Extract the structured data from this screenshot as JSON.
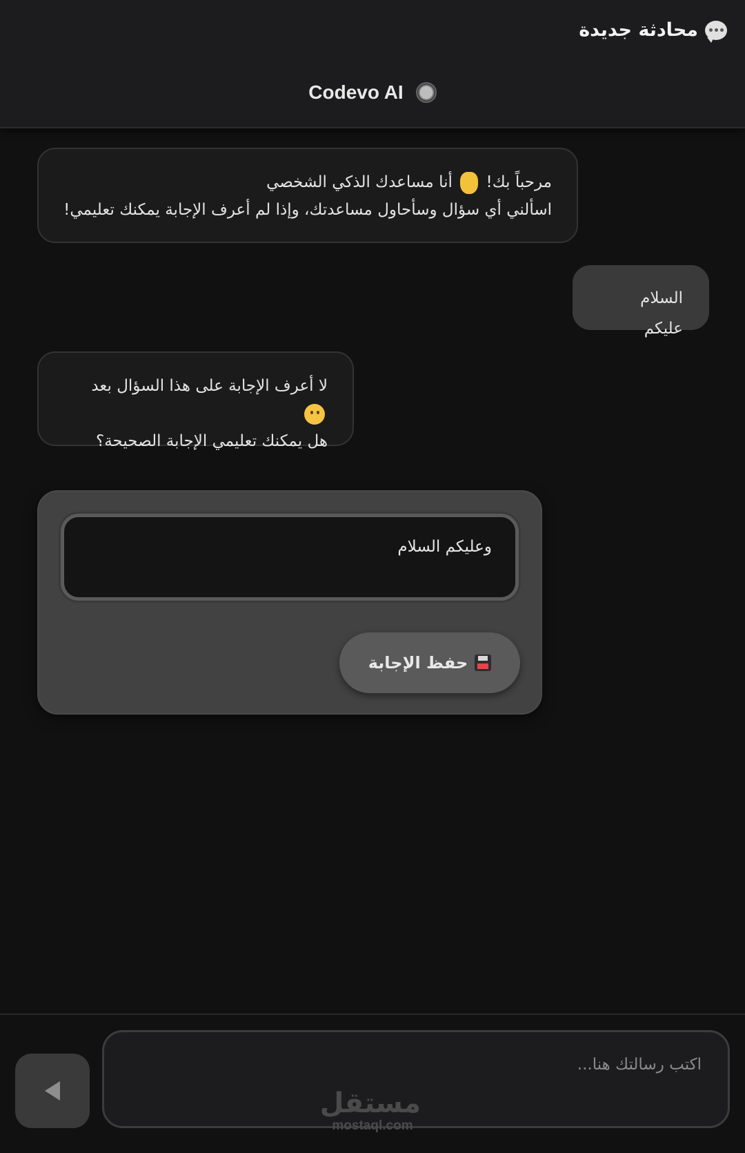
{
  "header": {
    "new_chat_label": "محادثة جديدة",
    "new_chat_icon": "speech-balloon-icon",
    "assistant_name": "Codevo AI",
    "status_icon": "status-dot-icon"
  },
  "messages": [
    {
      "role": "bot",
      "line1": "مرحباً بك! 👋 أنا مساعدك الذكي الشخصي",
      "line1_a": "مرحباً بك!",
      "line1_b": "أنا مساعدك الذكي الشخصي",
      "line2": "اسألني أي سؤال وسأحاول مساعدتك، وإذا لم أعرف الإجابة يمكنك تعليمي!"
    },
    {
      "role": "user",
      "text": "السلام عليكم"
    },
    {
      "role": "bot",
      "line1": "لا أعرف الإجابة على هذا السؤال بعد",
      "line2": "هل يمكنك تعليمي الإجابة الصحيحة؟"
    }
  ],
  "teach": {
    "answer_value": "وعليكم السلام",
    "save_label": "حفظ الإجابة",
    "save_icon": "floppy-disk-icon"
  },
  "composer": {
    "placeholder": "اكتب رسالتك هنا...",
    "send_icon": "send-arrow-icon"
  },
  "watermark": {
    "arabic": "مستقل",
    "latin": "mostaql.com"
  },
  "colors": {
    "background": "#111112",
    "header": "#1c1c1e",
    "user_bubble": "#3a3a3b",
    "teach_panel": "#424243",
    "button": "#5a5a5b"
  }
}
